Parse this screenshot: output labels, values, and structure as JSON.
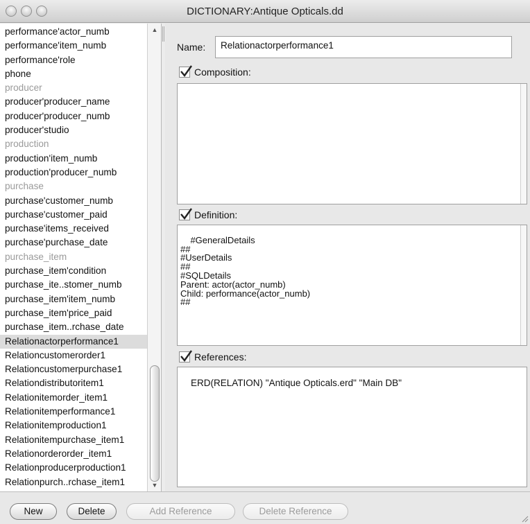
{
  "window": {
    "title": "DICTIONARY:Antique Opticals.dd"
  },
  "list": {
    "items": [
      {
        "label": "performance'actor_numb",
        "group": false
      },
      {
        "label": "performance'item_numb",
        "group": false
      },
      {
        "label": "performance'role",
        "group": false
      },
      {
        "label": "phone",
        "group": false
      },
      {
        "label": "producer",
        "group": true
      },
      {
        "label": "producer'producer_name",
        "group": false
      },
      {
        "label": "producer'producer_numb",
        "group": false
      },
      {
        "label": "producer'studio",
        "group": false
      },
      {
        "label": "production",
        "group": true
      },
      {
        "label": "production'item_numb",
        "group": false
      },
      {
        "label": "production'producer_numb",
        "group": false
      },
      {
        "label": "purchase",
        "group": true
      },
      {
        "label": "purchase'customer_numb",
        "group": false
      },
      {
        "label": "purchase'customer_paid",
        "group": false
      },
      {
        "label": "purchase'items_received",
        "group": false
      },
      {
        "label": "purchase'purchase_date",
        "group": false
      },
      {
        "label": "purchase_item",
        "group": true
      },
      {
        "label": "purchase_item'condition",
        "group": false
      },
      {
        "label": "purchase_ite..stomer_numb",
        "group": false
      },
      {
        "label": "purchase_item'item_numb",
        "group": false
      },
      {
        "label": "purchase_item'price_paid",
        "group": false
      },
      {
        "label": "purchase_item..rchase_date",
        "group": false
      },
      {
        "label": "Relationactorperformance1",
        "group": false,
        "selected": true
      },
      {
        "label": "Relationcustomerorder1",
        "group": false
      },
      {
        "label": "Relationcustomerpurchase1",
        "group": false
      },
      {
        "label": "Relationdistributoritem1",
        "group": false
      },
      {
        "label": "Relationitemorder_item1",
        "group": false
      },
      {
        "label": "Relationitemperformance1",
        "group": false
      },
      {
        "label": "Relationitemproduction1",
        "group": false
      },
      {
        "label": "Relationitempurchase_item1",
        "group": false
      },
      {
        "label": "Relationorderorder_item1",
        "group": false
      },
      {
        "label": "Relationproducerproduction1",
        "group": false
      },
      {
        "label": "Relationpurch..rchase_item1",
        "group": false
      }
    ]
  },
  "detail": {
    "name_label": "Name:",
    "name_value": "Relationactorperformance1",
    "composition_label": "Composition:",
    "composition_checked": true,
    "composition_text": "",
    "definition_label": "Definition:",
    "definition_checked": true,
    "definition_text": "#GeneralDetails\n##\n#UserDetails\n##\n#SQLDetails\nParent: actor(actor_numb)\nChild: performance(actor_numb)\n##",
    "references_label": "References:",
    "references_checked": true,
    "references_text": "ERD(RELATION) \"Antique Opticals.erd\" \"Main DB\""
  },
  "buttons": {
    "new": "New",
    "delete": "Delete",
    "add_reference": "Add Reference",
    "delete_reference": "Delete Reference"
  }
}
